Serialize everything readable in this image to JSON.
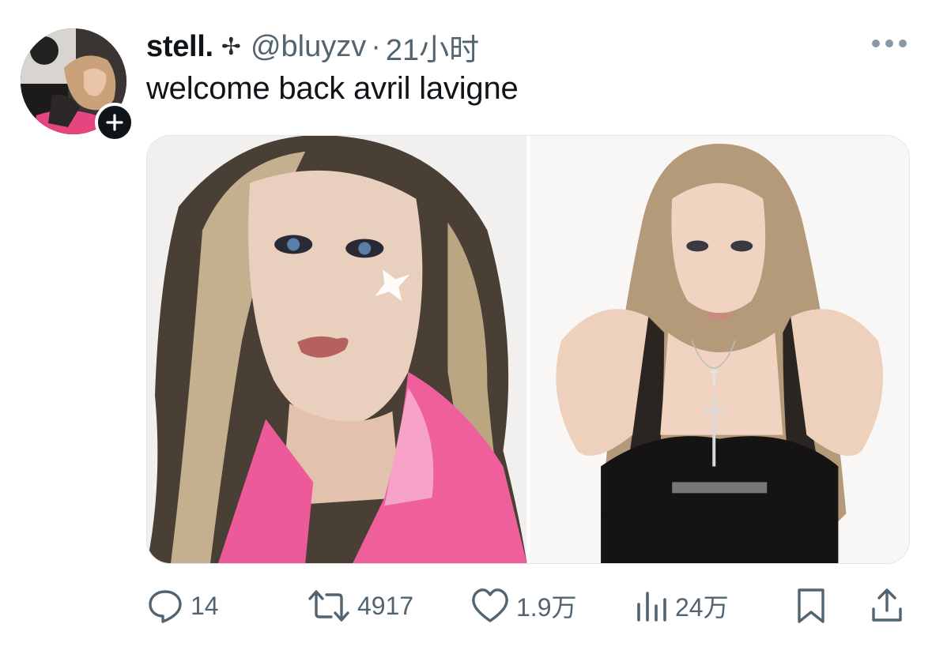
{
  "tweet": {
    "display_name": "stell.",
    "name_emoji": "✢",
    "handle": "@bluyzv",
    "separator": "·",
    "time": "21小时",
    "text": "welcome back avril lavigne"
  },
  "media": [
    {
      "icon": "photo"
    },
    {
      "icon": "photo"
    }
  ],
  "actions": {
    "reply_count": "14",
    "retweet_count": "4917",
    "like_count": "1.9万",
    "views_count": "24万"
  },
  "colors": {
    "text_primary": "#0f1419",
    "text_secondary": "#536471",
    "accent_pink": "#ec5a9a"
  }
}
